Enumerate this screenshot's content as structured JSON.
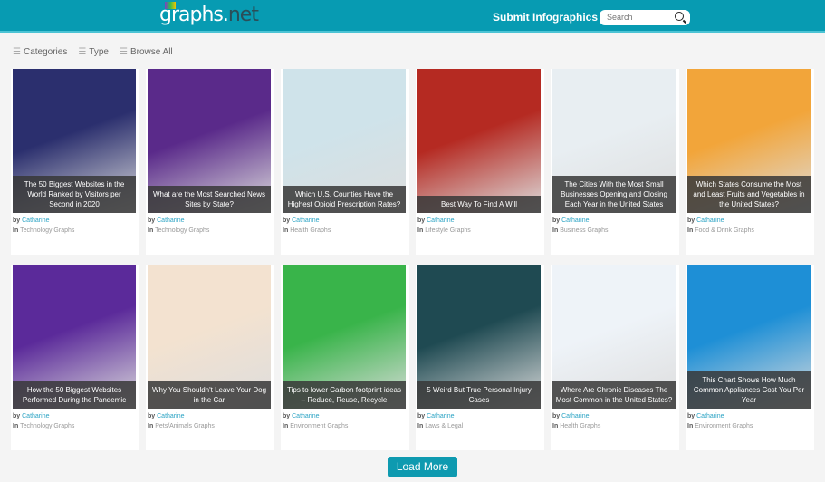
{
  "header": {
    "logo": "graphs.",
    "logo_tld": "net",
    "submit_label": "Submit Infographics",
    "search_placeholder": "Search"
  },
  "filters": [
    "Categories",
    "Type",
    "Browse All"
  ],
  "by_label": "by",
  "in_label": "In",
  "cards": [
    {
      "title": "The 50 Biggest Websites in the World Ranked by Visitors per Second in 2020",
      "author": "Catharine",
      "category": "Technology Graphs",
      "color": "#2b2f6e"
    },
    {
      "title": "What are the Most Searched News Sites by State?",
      "author": "Catharine",
      "category": "Technology Graphs",
      "color": "#5a2a8a"
    },
    {
      "title": "Which U.S. Counties Have the Highest Opioid Prescription Rates?",
      "author": "Catharine",
      "category": "Health Graphs",
      "color": "#cfe3ea"
    },
    {
      "title": "Best Way To Find A Will",
      "author": "Catharine",
      "category": "Lifestyle Graphs",
      "color": "#b52a22"
    },
    {
      "title": "The Cities With the Most Small Businesses Opening and Closing Each Year in the United States",
      "author": "Catharine",
      "category": "Business Graphs",
      "color": "#e8eef2"
    },
    {
      "title": "Which States Consume the Most and Least Fruits and Vegetables in the United States?",
      "author": "Catharine",
      "category": "Food & Drink Graphs",
      "color": "#f2a53a"
    },
    {
      "title": "How the 50 Biggest Websites Performed During the Pandemic",
      "author": "Catharine",
      "category": "Technology Graphs",
      "color": "#5b2a9a"
    },
    {
      "title": "Why You Shouldn't Leave Your Dog in the Car",
      "author": "Catharine",
      "category": "Pets/Animals Graphs",
      "color": "#f3e2d0"
    },
    {
      "title": "Tips to lower Carbon footprint ideas – Reduce, Reuse, Recycle",
      "author": "Catharine",
      "category": "Environment Graphs",
      "color": "#39b44a"
    },
    {
      "title": "5 Weird But True Personal Injury Cases",
      "author": "Catharine",
      "category": "Laws & Legal",
      "color": "#1f4a52"
    },
    {
      "title": "Where Are Chronic Diseases The Most Common in the United States?",
      "author": "Catharine",
      "category": "Health Graphs",
      "color": "#eef3f8"
    },
    {
      "title": "This Chart Shows How Much Common Appliances Cost You Per Year",
      "author": "Catharine",
      "category": "Environment Graphs",
      "color": "#1e8fd6"
    }
  ],
  "load_more": "Load More"
}
